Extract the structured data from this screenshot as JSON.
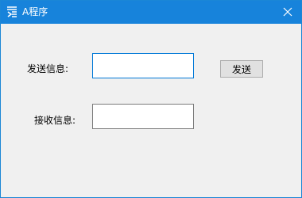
{
  "window": {
    "title": "A程序",
    "app_icon": "logo-icon",
    "close_icon": "close-icon"
  },
  "form": {
    "send_label": "发送信息:",
    "send_value": "",
    "send_button": "发送",
    "receive_label": "接收信息:",
    "receive_value": ""
  },
  "colors": {
    "titlebar": "#1783db",
    "background": "#f0f0f0",
    "focus_border": "#0078d7"
  }
}
